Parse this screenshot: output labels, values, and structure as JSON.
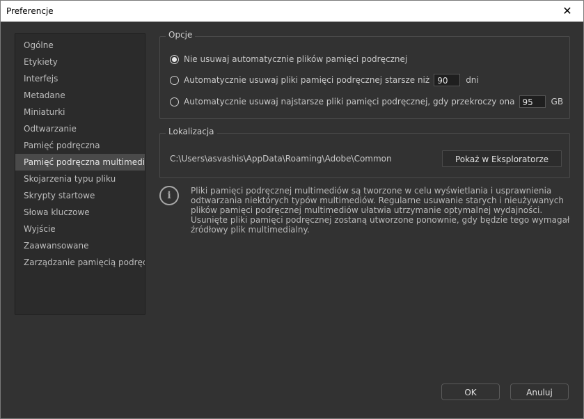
{
  "window": {
    "title": "Preferencje",
    "close_glyph": "✕"
  },
  "sidebar": {
    "items": [
      {
        "label": "Ogólne"
      },
      {
        "label": "Etykiety"
      },
      {
        "label": "Interfejs"
      },
      {
        "label": "Metadane"
      },
      {
        "label": "Miniaturki"
      },
      {
        "label": "Odtwarzanie"
      },
      {
        "label": "Pamięć podręczna"
      },
      {
        "label": "Pamięć podręczna multimediów"
      },
      {
        "label": "Skojarzenia typu pliku"
      },
      {
        "label": "Skrypty startowe"
      },
      {
        "label": "Słowa kluczowe"
      },
      {
        "label": "Wyjście"
      },
      {
        "label": "Zaawansowane"
      },
      {
        "label": "Zarządzanie pamięcią podręczną"
      }
    ],
    "selected": "Pamięć podręczna multimediów"
  },
  "options": {
    "title": "Opcje",
    "radio1": "Nie usuwaj automatycznie plików pamięci podręcznej",
    "radio2": "Automatycznie usuwaj pliki pamięci podręcznej starsze niż",
    "radio2_value": "90",
    "radio2_unit": "dni",
    "radio3": "Automatycznie usuwaj najstarsze pliki pamięci podręcznej, gdy przekroczy ona",
    "radio3_value": "95",
    "radio3_unit": "GB",
    "selected": "radio1"
  },
  "location": {
    "title": "Lokalizacja",
    "path": "C:\\Users\\asvashis\\AppData\\Roaming\\Adobe\\Common",
    "show_button": "Pokaż w Eksploratorze"
  },
  "info": {
    "text": "Pliki pamięci podręcznej multimediów są tworzone w celu wyświetlania i usprawnienia odtwarzania niektórych typów multimediów. Regularne usuwanie starych i nieużywanych plików pamięci podręcznej multimediów ułatwia utrzymanie optymalnej wydajności. Usunięte pliki pamięci podręcznej zostaną utworzone ponownie, gdy będzie tego wymagał źródłowy plik multimedialny.",
    "icon_glyph": "i"
  },
  "footer": {
    "ok": "OK",
    "cancel": "Anuluj"
  }
}
